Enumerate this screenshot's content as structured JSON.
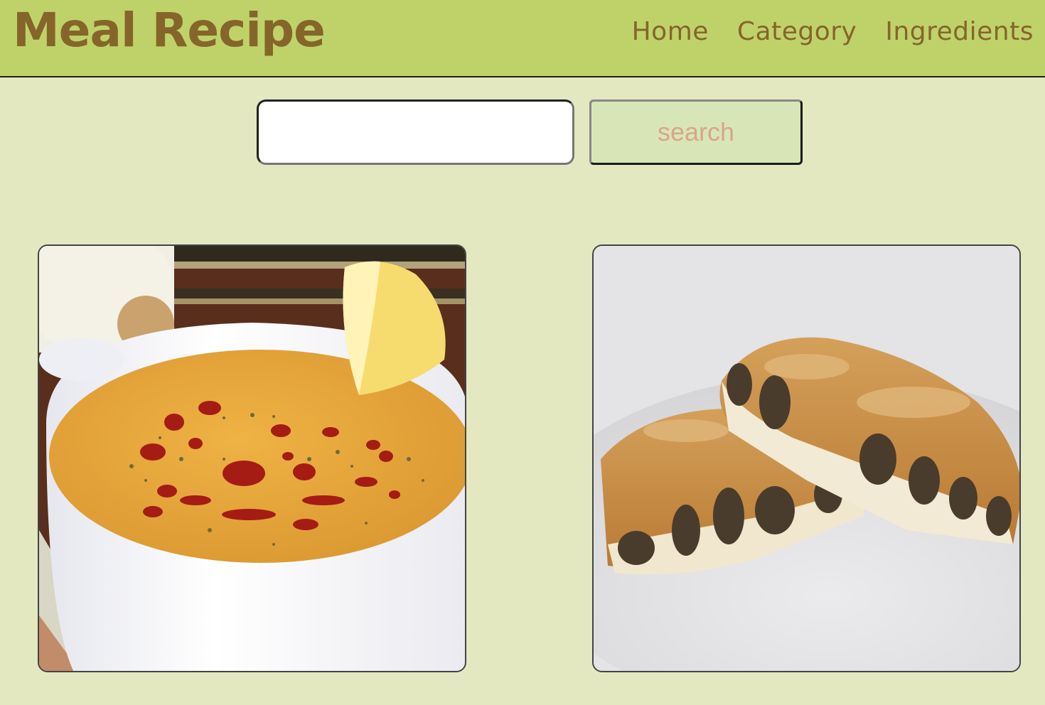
{
  "header": {
    "brand": "Meal Recipe",
    "nav": [
      {
        "label": "Home"
      },
      {
        "label": "Category"
      },
      {
        "label": "Ingredients"
      }
    ]
  },
  "search": {
    "value": "",
    "placeholder": "",
    "button_label": "search"
  },
  "meals": [
    {
      "image": "lentil-soup-photo"
    },
    {
      "image": "meat-borek-pastry-photo"
    }
  ],
  "colors": {
    "header_bg": "#bfd26a",
    "page_bg": "#e3e8c1",
    "brand_text": "#85652a",
    "button_bg": "#d8e6b7",
    "button_text": "#d9a58a"
  }
}
